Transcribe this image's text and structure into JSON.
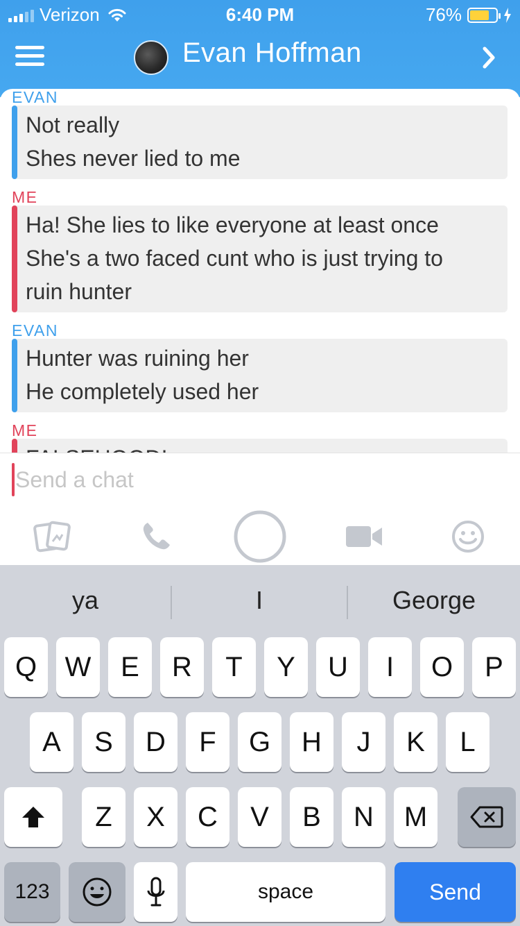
{
  "status": {
    "carrier": "Verizon",
    "time": "6:40 PM",
    "battery": "76%",
    "battery_level": 0.76
  },
  "header": {
    "title": "Evan Hoffman"
  },
  "messages": [
    {
      "sender": "EVAN",
      "from": "evan",
      "lines": [
        "Not really",
        "Shes never lied to me"
      ]
    },
    {
      "sender": "ME",
      "from": "me",
      "lines": [
        "Ha! She lies to like everyone at least once",
        "She's a two faced cunt who is just trying to",
        "ruin hunter"
      ]
    },
    {
      "sender": "EVAN",
      "from": "evan",
      "lines": [
        "Hunter was ruining her",
        "He completely used her"
      ]
    },
    {
      "sender": "ME",
      "from": "me",
      "lines": [
        "FALSEHOOD!"
      ]
    }
  ],
  "input": {
    "placeholder": "Send a chat"
  },
  "keyboard": {
    "suggestions": [
      "ya",
      "I",
      "George"
    ],
    "row1": [
      "Q",
      "W",
      "E",
      "R",
      "T",
      "Y",
      "U",
      "I",
      "O",
      "P"
    ],
    "row2": [
      "A",
      "S",
      "D",
      "F",
      "G",
      "H",
      "J",
      "K",
      "L"
    ],
    "row3": [
      "Z",
      "X",
      "C",
      "V",
      "B",
      "N",
      "M"
    ],
    "numbers_label": "123",
    "space_label": "space",
    "send_label": "Send"
  },
  "colors": {
    "accent_blue": "#3fa0ec",
    "accent_red": "#e1435a",
    "send_blue": "#2f7ff0"
  }
}
